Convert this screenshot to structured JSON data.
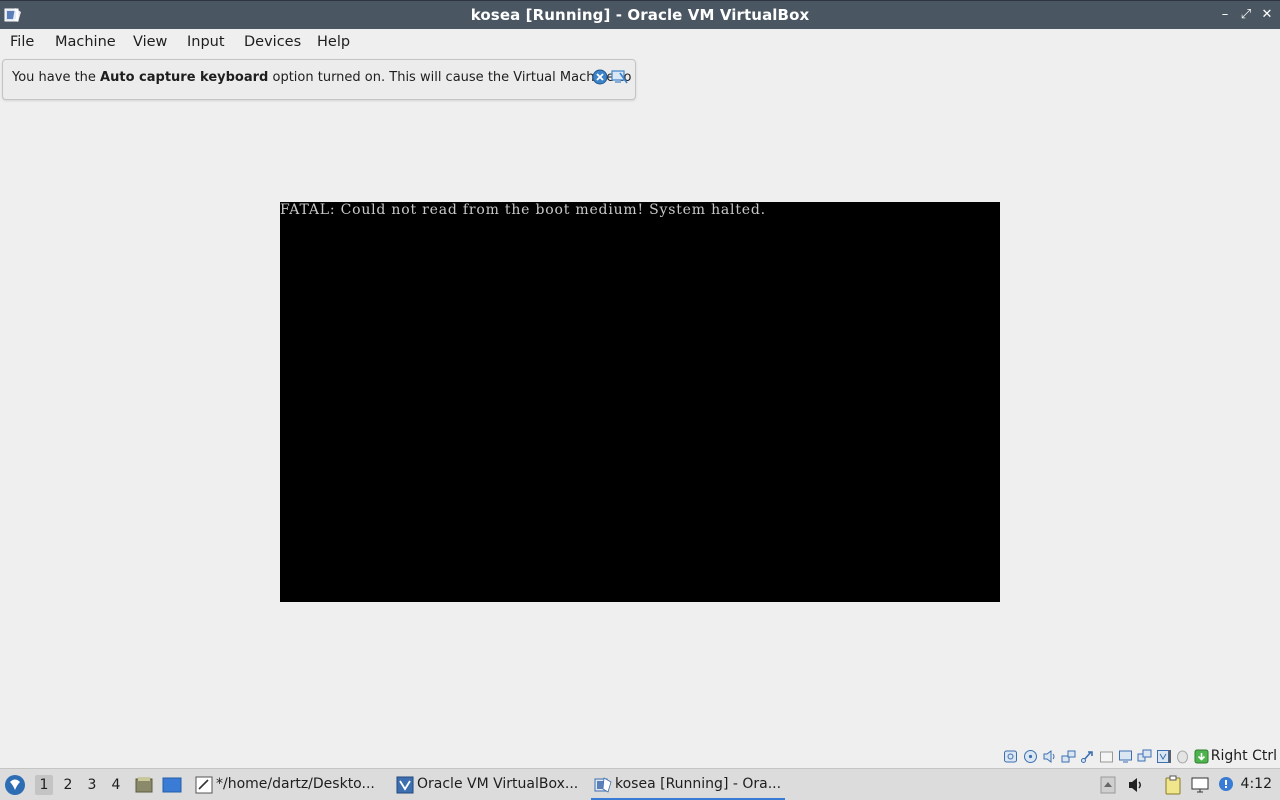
{
  "window": {
    "title": "kosea [Running] - Oracle VM VirtualBox",
    "controls": {
      "minimize": "–",
      "restore": "⤢",
      "close": "✕"
    }
  },
  "menu": {
    "items": [
      "File",
      "Machine",
      "View",
      "Input",
      "Devices",
      "Help"
    ]
  },
  "notice": {
    "prefix": "You have the ",
    "bold": "Auto capture keyboard",
    "suffix": " option turned on. This will cause the Virtual Machine to"
  },
  "vm": {
    "console_text": "FATAL: Could not read from the boot medium! System halted."
  },
  "statusbar": {
    "icons": [
      "hard-disk-icon",
      "optical-drive-icon",
      "audio-icon",
      "network-icon",
      "usb-icon",
      "shared-folders-icon",
      "display-icon",
      "video-capture-icon",
      "virtualization-icon",
      "mouse-integration-icon",
      "keyboard-capture-icon"
    ],
    "host_key": "Right Ctrl"
  },
  "taskbar": {
    "workspaces": [
      "1",
      "2",
      "3",
      "4"
    ],
    "active_workspace": "1",
    "tasks": [
      {
        "label": "*/home/dartz/Deskto...",
        "icon": "text-editor-icon"
      },
      {
        "label": "Oracle VM VirtualBox...",
        "icon": "virtualbox-manager-icon"
      },
      {
        "label": "kosea [Running] - Ora...",
        "icon": "virtualbox-vm-icon"
      }
    ],
    "clock": "4:12"
  },
  "colors": {
    "titlebar": "#4a5763",
    "background": "#efefef",
    "vm_screen": "#000000",
    "console_text": "#c8c8c8",
    "accent": "#3a7bd5"
  }
}
